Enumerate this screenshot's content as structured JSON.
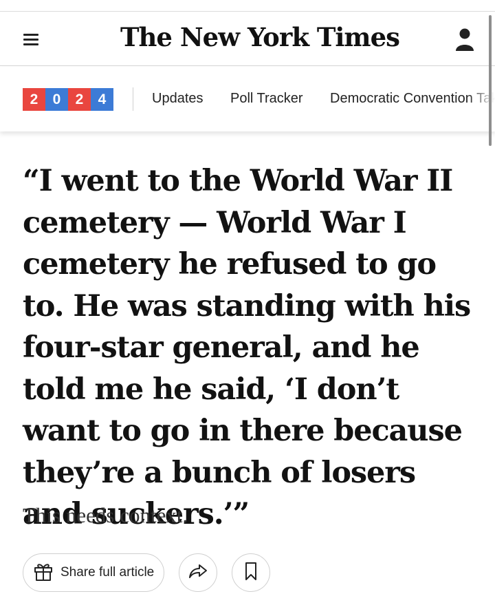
{
  "masthead": {
    "logo_text": "The New York Times",
    "menu_icon": "hamburger-menu-icon",
    "account_icon": "user-account-icon"
  },
  "section_nav": {
    "badge": [
      {
        "digit": "2",
        "color": "#e9463f"
      },
      {
        "digit": "0",
        "color": "#3c7bd6"
      },
      {
        "digit": "2",
        "color": "#e9463f"
      },
      {
        "digit": "4",
        "color": "#3c7bd6"
      }
    ],
    "links": [
      "Updates",
      "Poll Tracker",
      "Democratic Convention Takeaways"
    ]
  },
  "article": {
    "headline": "“I went to the World War II cemetery — World War I cemetery he refused to go to. He was standing with his four-star general, and he told me he said, ‘I don’t want to go in there because they’re a bunch of losers and suckers.’”",
    "summary": "This needs context."
  },
  "actions": {
    "share_label": "Share full article",
    "share_icon": "gift-icon",
    "forward_icon": "share-arrow-icon",
    "save_icon": "bookmark-icon"
  }
}
